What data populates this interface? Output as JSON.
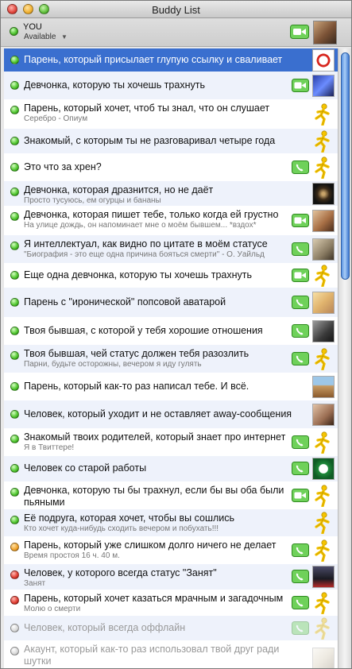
{
  "window": {
    "title": "Buddy List"
  },
  "me": {
    "name": "YOU",
    "status": "Available"
  },
  "buddies": [
    {
      "name": "Парень, который присылает глупую ссылку и сваливает",
      "sub": "",
      "status": "available",
      "cap": "",
      "avatar": "photo-globe",
      "selected": true
    },
    {
      "name": "Девчонка, которую ты хочешь трахнуть",
      "sub": "",
      "status": "available",
      "cap": "video",
      "avatar": "photo-blue"
    },
    {
      "name": "Парень, который хочет, чтоб ты знал, что он слушает",
      "sub": "Серебро - Опиум",
      "status": "available",
      "cap": "",
      "avatar": "aim-running-man"
    },
    {
      "name": "Знакомый, с которым ты не разговаривал четыре года",
      "sub": "",
      "status": "available",
      "cap": "",
      "avatar": "aim-running-man"
    },
    {
      "name": "Это что за хрен?",
      "sub": "",
      "status": "available",
      "cap": "phone",
      "avatar": "aim-running-man"
    },
    {
      "name": "Девчонка, которая дразнится, но не даёт",
      "sub": "Просто тусуюсь, ем огурцы и бананы",
      "status": "available",
      "cap": "",
      "avatar": "photo-dark-star"
    },
    {
      "name": "Девчонка, которая пишет тебе, только когда ей грустно",
      "sub": "На улице дождь, он напоминает мне о моём бывшем... *вздох*",
      "status": "available",
      "cap": "video",
      "avatar": "photo-girl"
    },
    {
      "name": "Я интеллектуал, как видно по цитате в моём статусе",
      "sub": "\"Биография - это еще одна причина бояться смерти\" - О. Уайльд",
      "status": "available",
      "cap": "phone",
      "avatar": "photo-portrait"
    },
    {
      "name": "Еще одна девчонка, которую ты хочешь трахнуть",
      "sub": "",
      "status": "available",
      "cap": "video",
      "avatar": "aim-running-man"
    },
    {
      "name": "Парень с \"иронической\" попсовой аватарой",
      "sub": "",
      "status": "available",
      "cap": "phone",
      "avatar": "photo-blonde"
    },
    {
      "name": "Твоя бывшая, с которой у тебя хорошие отношения",
      "sub": "",
      "status": "available",
      "cap": "phone",
      "avatar": "photo-cat"
    },
    {
      "name": "Твоя бывшая, чей статус должен тебя разозлить",
      "sub": "Парни, будьте осторожны, вечером я иду гулять",
      "status": "available",
      "cap": "phone",
      "avatar": "aim-running-man"
    },
    {
      "name": "Парень, который как-то раз написал тебе. И всё.",
      "sub": "",
      "status": "available",
      "cap": "",
      "avatar": "photo-beach"
    },
    {
      "name": "Человек, который уходит и не оставляет away-сообщения",
      "sub": "",
      "status": "available",
      "cap": "",
      "avatar": "photo-face"
    },
    {
      "name": "Знакомый твоих родителей, который знает про интернет",
      "sub": "Я в Твиттере!",
      "status": "available",
      "cap": "phone",
      "avatar": "aim-running-man"
    },
    {
      "name": "Человек со старой работы",
      "sub": "",
      "status": "available",
      "cap": "phone",
      "avatar": "photo-celtics"
    },
    {
      "name": "Девчонка, которую ты бы трахнул, если бы вы оба были пьяными",
      "sub": "",
      "status": "available",
      "cap": "video",
      "avatar": "aim-running-man",
      "wrap": true
    },
    {
      "name": "Её подруга, которая хочет, чтобы вы сошлись",
      "sub": "Кто хочет куда-нибудь сходить вечером и побухать!!!",
      "status": "available",
      "cap": "",
      "avatar": "aim-running-man"
    },
    {
      "name": "Парень, который уже слишком долго ничего не делает",
      "sub": "Время простоя 16 ч. 40 м.",
      "status": "away",
      "cap": "phone",
      "avatar": "aim-running-man"
    },
    {
      "name": "Человек, у которого всегда статус \"Занят\"",
      "sub": "Занят",
      "status": "busy",
      "cap": "phone",
      "avatar": "photo-dark"
    },
    {
      "name": "Парень, который хочет казаться мрачным и загадочным",
      "sub": "Молю о смерти",
      "status": "busy",
      "cap": "phone",
      "avatar": "aim-running-man"
    },
    {
      "name": "Человек, который всегда оффлайн",
      "sub": "",
      "status": "offline",
      "cap": "phone",
      "avatar": "aim-running-man"
    },
    {
      "name": "Акаунт, который как-то раз использовал твой друг ради шутки",
      "sub": "",
      "status": "offline",
      "cap": "",
      "avatar": "photo-sketch",
      "wrap": true
    }
  ],
  "colors": {
    "selection": "#3a6fcf",
    "alt_row": "#eef2fb",
    "aim_yellow": "#f5c400"
  }
}
